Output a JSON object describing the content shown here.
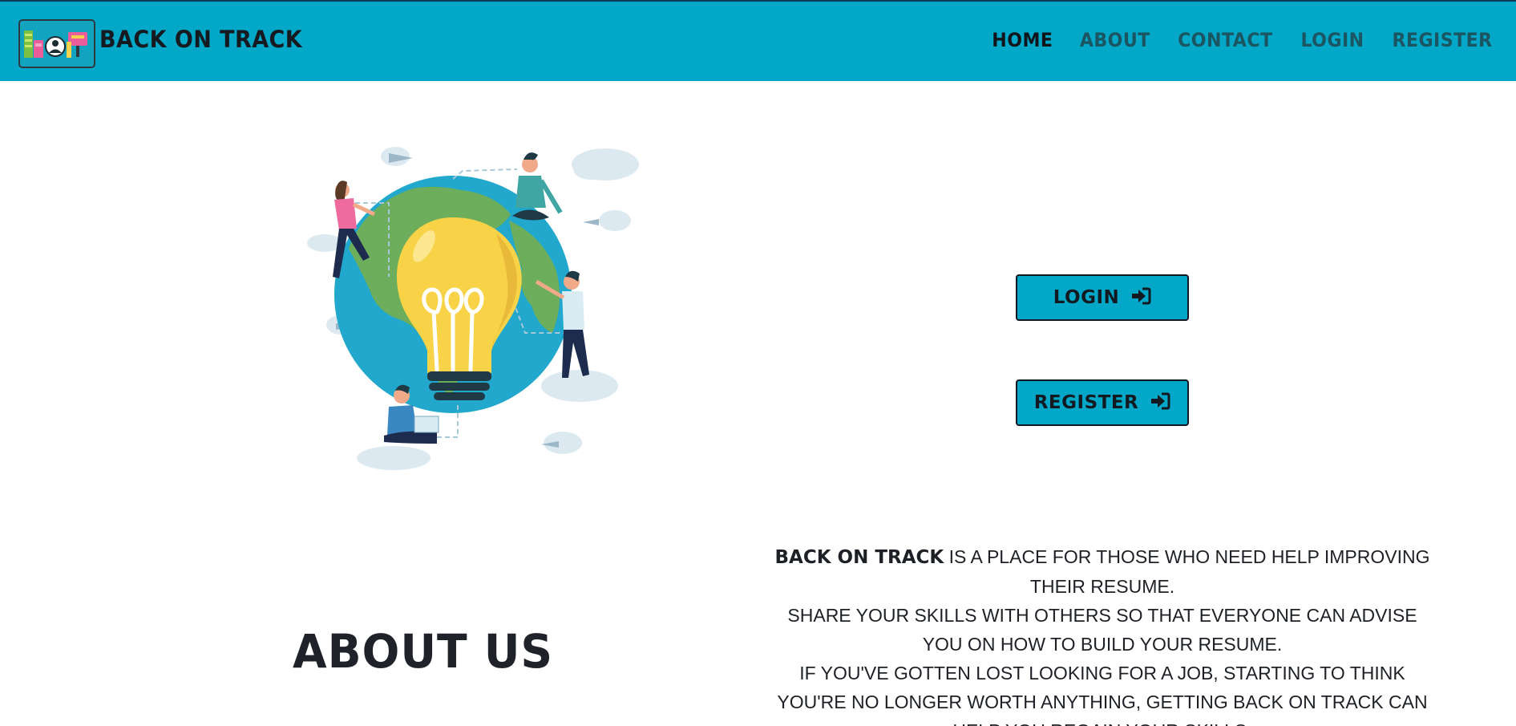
{
  "brand": {
    "name": "BACK ON TRACK",
    "logo_icon": "community-logo-icon"
  },
  "nav": {
    "items": [
      {
        "label": "HOME",
        "active": true
      },
      {
        "label": "ABOUT",
        "active": false
      },
      {
        "label": "CONTACT",
        "active": false
      },
      {
        "label": "LOGIN",
        "active": false
      },
      {
        "label": "REGISTER",
        "active": false
      }
    ]
  },
  "hero": {
    "illustration": "globe-lightbulb-people-illustration"
  },
  "actions": {
    "login_label": "LOGIN",
    "register_label": "REGISTER",
    "icon": "sign-in-icon"
  },
  "about": {
    "title": "ABOUT US",
    "brand_inline": "BACK ON TRACK",
    "line1": " IS A PLACE FOR THOSE WHO NEED HELP IMPROVING THEIR RESUME.",
    "line2": "SHARE YOUR SKILLS WITH OTHERS SO THAT EVERYONE CAN ADVISE YOU ON HOW TO BUILD YOUR RESUME.",
    "line3": "IF YOU'VE GOTTEN LOST LOOKING FOR A JOB, STARTING TO THINK YOU'RE NO LONGER WORTH ANYTHING, GETTING BACK ON TRACK CAN HELP YOU REGAIN YOUR SKILLS."
  },
  "colors": {
    "accent": "#03a8c8",
    "text_dark": "#1c1f24",
    "bulb": "#f8d347",
    "globe_ocean": "#21a8cc",
    "globe_land": "#6cae5b"
  }
}
